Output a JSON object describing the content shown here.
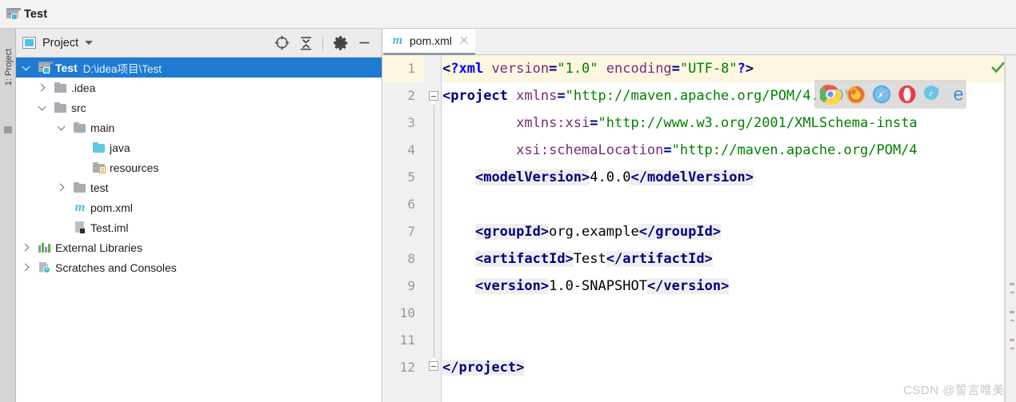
{
  "window": {
    "title": "Test",
    "title_icon": "module-folder-icon"
  },
  "toolstrip": {
    "project_tab": "1: Project"
  },
  "project_panel": {
    "header": {
      "icon": "project-view-icon",
      "title": "Project",
      "dropdown_icon": "chevron-down-icon",
      "actions": [
        {
          "name": "select-opened-file-icon",
          "tooltip": "Select Opened File"
        },
        {
          "name": "collapse-all-icon",
          "tooltip": "Collapse All"
        },
        {
          "name": "gear-icon",
          "tooltip": "Settings"
        },
        {
          "name": "minimize-icon",
          "tooltip": "Hide"
        }
      ]
    },
    "tree": [
      {
        "label": "Test",
        "sublabel": "D:\\idea项目\\Test",
        "indent": 0,
        "arrow": "down",
        "icon": "module-folder-icon",
        "selected": true,
        "bold": true
      },
      {
        "label": ".idea",
        "sublabel": "",
        "indent": 1,
        "arrow": "right",
        "icon": "folder-grey-icon",
        "selected": false,
        "bold": false
      },
      {
        "label": "src",
        "sublabel": "",
        "indent": 1,
        "arrow": "down",
        "icon": "folder-grey-icon",
        "selected": false,
        "bold": false
      },
      {
        "label": "main",
        "sublabel": "",
        "indent": 2,
        "arrow": "down",
        "icon": "folder-grey-icon",
        "selected": false,
        "bold": false
      },
      {
        "label": "java",
        "sublabel": "",
        "indent": 3,
        "arrow": "none",
        "icon": "folder-sources-blue-icon",
        "selected": false,
        "bold": false
      },
      {
        "label": "resources",
        "sublabel": "",
        "indent": 3,
        "arrow": "none",
        "icon": "folder-resources-icon",
        "selected": false,
        "bold": false
      },
      {
        "label": "test",
        "sublabel": "",
        "indent": 2,
        "arrow": "right",
        "icon": "folder-grey-icon",
        "selected": false,
        "bold": false
      },
      {
        "label": "pom.xml",
        "sublabel": "",
        "indent": 2,
        "arrow": "none",
        "icon": "maven-file-icon",
        "selected": false,
        "bold": false
      },
      {
        "label": "Test.iml",
        "sublabel": "",
        "indent": 2,
        "arrow": "none",
        "icon": "iml-file-icon",
        "selected": false,
        "bold": false
      },
      {
        "label": "External Libraries",
        "sublabel": "",
        "indent": 0,
        "arrow": "right",
        "icon": "external-libraries-icon",
        "selected": false,
        "bold": false
      },
      {
        "label": "Scratches and Consoles",
        "sublabel": "",
        "indent": 0,
        "arrow": "right",
        "icon": "scratches-icon",
        "selected": false,
        "bold": false
      }
    ]
  },
  "editor": {
    "tab": {
      "icon": "maven-file-icon",
      "label": "pom.xml",
      "close_icon": "close-icon"
    },
    "inspection_status_icon": "green-check-icon",
    "current_line": 1,
    "line_numbers": [
      1,
      2,
      3,
      4,
      5,
      6,
      7,
      8,
      9,
      10,
      11,
      12
    ],
    "code_lines": [
      {
        "n": 1,
        "text": "<?xml version=\"1.0\" encoding=\"UTF-8\"?>"
      },
      {
        "n": 2,
        "text": "<project xmlns=\"http://maven.apache.org/POM/4.0.0\""
      },
      {
        "n": 3,
        "text": "         xmlns:xsi=\"http://www.w3.org/2001/XMLSchema-insta"
      },
      {
        "n": 4,
        "text": "         xsi:schemaLocation=\"http://maven.apache.org/POM/4"
      },
      {
        "n": 5,
        "text": "    <modelVersion>4.0.0</modelVersion>"
      },
      {
        "n": 6,
        "text": ""
      },
      {
        "n": 7,
        "text": "    <groupId>org.example</groupId>"
      },
      {
        "n": 8,
        "text": "    <artifactId>Test</artifactId>"
      },
      {
        "n": 9,
        "text": "    <version>1.0-SNAPSHOT</version>"
      },
      {
        "n": 10,
        "text": ""
      },
      {
        "n": 11,
        "text": ""
      },
      {
        "n": 12,
        "text": "</project>"
      }
    ]
  },
  "browser_popup": {
    "browsers": [
      {
        "name": "chrome-icon",
        "label": "Chrome"
      },
      {
        "name": "firefox-icon",
        "label": "Firefox"
      },
      {
        "name": "safari-icon",
        "label": "Safari"
      },
      {
        "name": "opera-icon",
        "label": "Opera"
      },
      {
        "name": "internet-explorer-icon",
        "label": "Internet Explorer"
      },
      {
        "name": "edge-icon",
        "label": "Edge"
      }
    ]
  },
  "watermark": "CSDN @誓言唯美",
  "colors": {
    "selection_blue": "#1e7bd1",
    "tab_underline": "#8a9aad",
    "current_line_yellow": "#fdf6e1",
    "tag_name": "#000080",
    "attr_name": "#7a2a7a",
    "attr_value": "#008000",
    "keyword_blue": "#0000ff",
    "check_green": "#45a045"
  }
}
